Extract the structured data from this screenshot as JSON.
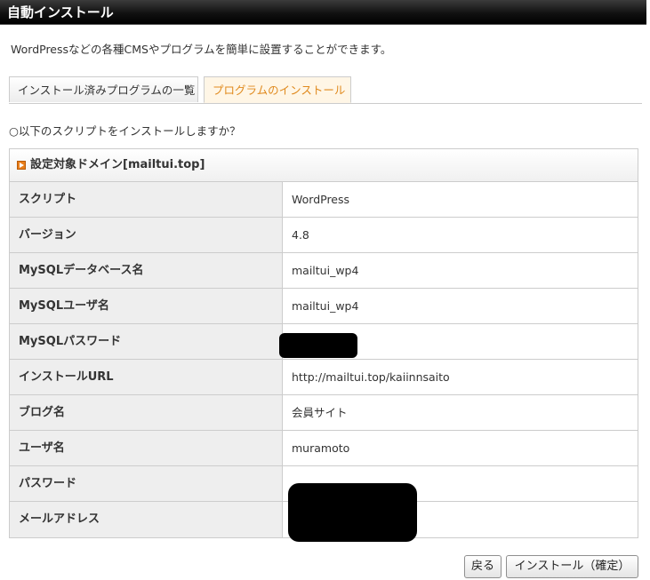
{
  "window": {
    "title": "自動インストール"
  },
  "description": "WordPressなどの各種CMSやプログラムを簡単に設置することができます。",
  "tabs": [
    {
      "label": "インストール済みプログラムの一覧",
      "active": false
    },
    {
      "label": "プログラムのインストール",
      "active": true
    }
  ],
  "question": "○以下のスクリプトをインストールしますか？",
  "table": {
    "header": "設定対象ドメイン[mailtui.top]",
    "rows": [
      {
        "label": "スクリプト",
        "value": "WordPress"
      },
      {
        "label": "バージョン",
        "value": "4.8"
      },
      {
        "label": "MySQLデータベース名",
        "value": "mailtui_wp4"
      },
      {
        "label": "MySQLユーザ名",
        "value": "mailtui_wp4"
      },
      {
        "label": "MySQLパスワード",
        "value": ""
      },
      {
        "label": "インストールURL",
        "value": "http://mailtui.top/kaiinnsaito"
      },
      {
        "label": "ブログ名",
        "value": "会員サイト"
      },
      {
        "label": "ユーザ名",
        "value": "muramoto"
      },
      {
        "label": "パスワード",
        "value": ""
      },
      {
        "label": "メールアドレス",
        "value": ""
      }
    ]
  },
  "buttons": {
    "back": "戻る",
    "install_confirm": "インストール（確定）"
  },
  "colors": {
    "active_tab_text": "#e08a1e",
    "active_tab_bg": "#fff6e6",
    "label_bg": "#eeeeee",
    "titlebar_bg": "#111111",
    "header_icon": "#e97e1a"
  }
}
